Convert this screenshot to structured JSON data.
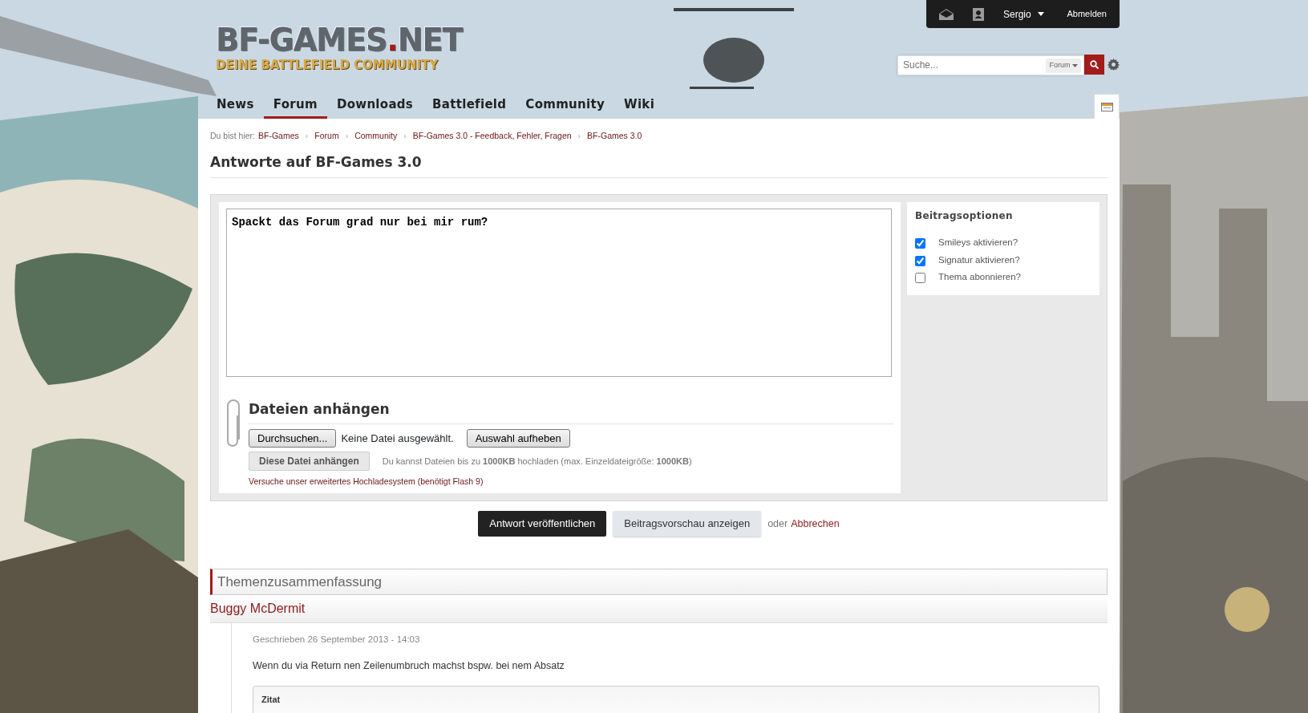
{
  "user_bar": {
    "user": "Sergio",
    "logout": "Abmelden"
  },
  "logo": {
    "name": "BF-GAMES",
    "dot": ".",
    "tld": "NET",
    "tagline": "DEINE BATTLEFIELD COMMUNITY"
  },
  "search": {
    "placeholder": "Suche...",
    "scope": "Forum"
  },
  "nav": [
    {
      "label": "News",
      "selected": false
    },
    {
      "label": "Forum",
      "selected": true
    },
    {
      "label": "Downloads",
      "selected": false
    },
    {
      "label": "Battlefield",
      "selected": false
    },
    {
      "label": "Community",
      "selected": false
    },
    {
      "label": "Wiki",
      "selected": false
    }
  ],
  "breadcrumb": {
    "prefix": "Du bist hier:",
    "separator": "›",
    "items": [
      "BF-Games",
      "Forum",
      "Community",
      "BF-Games 3.0 - Feedback, Fehler, Fragen",
      "BF-Games 3.0"
    ]
  },
  "page_title": "Antworte auf BF-Games 3.0",
  "editor": {
    "value": "Spackt das Forum grad nur bei mir rum?"
  },
  "options": {
    "title": "Beitragsoptionen",
    "items": [
      {
        "label": "Smileys aktivieren?",
        "checked": true
      },
      {
        "label": "Signatur aktivieren?",
        "checked": true
      },
      {
        "label": "Thema abonnieren?",
        "checked": false
      }
    ]
  },
  "attachments": {
    "title": "Dateien anhängen",
    "browse": "Durchsuchen...",
    "no_file": "Keine Datei ausgewählt.",
    "clear": "Auswahl aufheben",
    "attach": "Diese Datei anhängen",
    "limit_note": "Du kannst Dateien bis zu **1000KB** hochladen (max. Einzeldateigröße: **1000KB**)",
    "advanced_link": "Versuche unser erweitertes Hochladesystem (benötigt Flash 9)"
  },
  "actions": {
    "submit": "Antwort veröffentlichen",
    "preview": "Beitragsvorschau anzeigen",
    "or": "oder",
    "cancel": "Abbrechen"
  },
  "summary": {
    "title": "Themenzusammenfassung",
    "posts": [
      {
        "author": "Buggy McDermit",
        "date": "Geschrieben 26 September 2013 - 14:03",
        "text": "Wenn du via Return nen Zeilenumbruch machst bspw. bei nem Absatz",
        "quote_title": "Zitat"
      }
    ]
  }
}
